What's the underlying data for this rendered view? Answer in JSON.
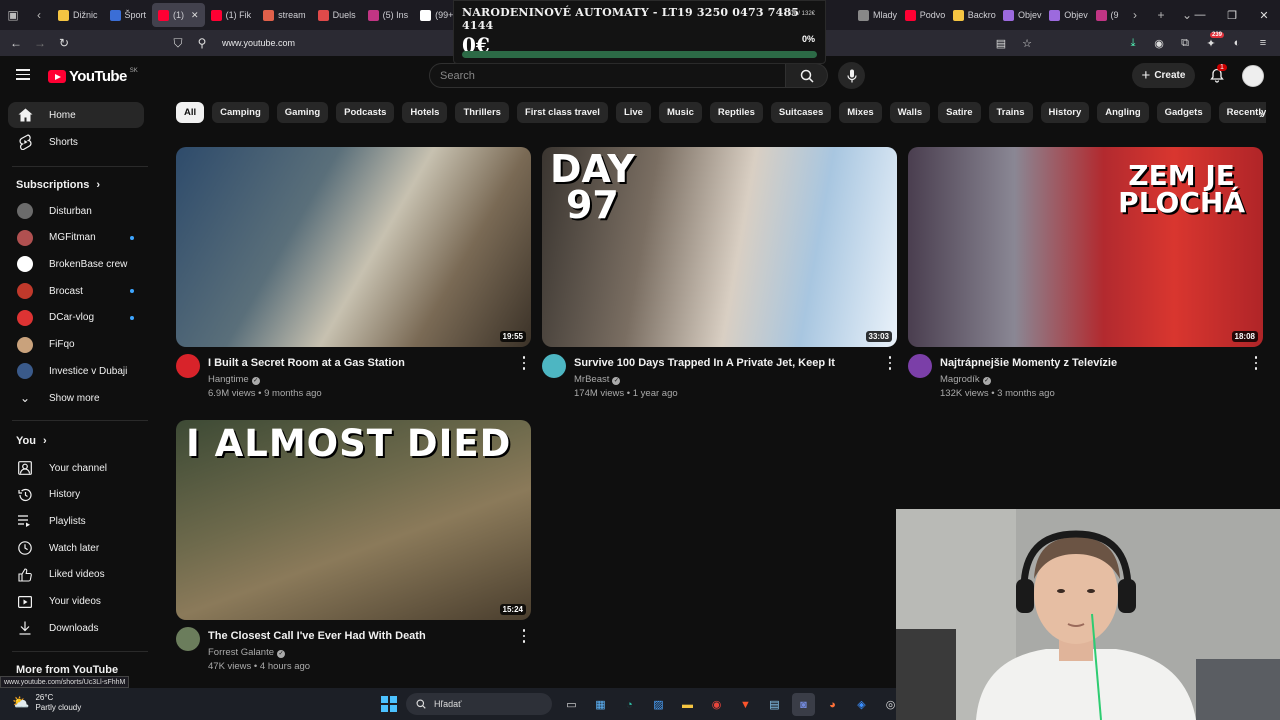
{
  "browser": {
    "tabs": [
      {
        "label": "Dižnic",
        "color": "#f5c542"
      },
      {
        "label": "Šport",
        "color": "#3b6ed6"
      },
      {
        "label": "(1)",
        "color": "#ff0033",
        "active": true
      },
      {
        "label": "(1) Fik",
        "color": "#ff0033"
      },
      {
        "label": "stream",
        "color": "#e0604a"
      },
      {
        "label": "Duels",
        "color": "#e04a4a"
      },
      {
        "label": "(5) Ins",
        "color": "#c13584"
      },
      {
        "label": "(99+)",
        "color": "#ffffff"
      }
    ],
    "tabs_right": [
      {
        "label": "Mlady",
        "color": "#888888"
      },
      {
        "label": "Podvo",
        "color": "#ff0033"
      },
      {
        "label": "Backro",
        "color": "#f5c542"
      },
      {
        "label": "Objev",
        "color": "#9c6ade"
      },
      {
        "label": "Objev",
        "color": "#9c6ade"
      },
      {
        "label": "(9",
        "color": "#c13584"
      }
    ],
    "url": "www.youtube.com",
    "ext_badge": "239",
    "status_url": "www.youtube.com/shorts/Uc3Ll-sFhhM"
  },
  "donation": {
    "title": "NARODENINOVÉ AUTOMATY - LT19 3250 0473 7485 4144",
    "goal": "0€ / 132€",
    "amount": "0€",
    "percent_label": "0%",
    "progress": 0
  },
  "header": {
    "logo": "YouTube",
    "region": "SK",
    "search_placeholder": "Search",
    "create_label": "Create",
    "notifications": "1"
  },
  "sidebar": {
    "home": "Home",
    "shorts": "Shorts",
    "subscriptions_header": "Subscriptions",
    "subscriptions": [
      {
        "name": "Disturban",
        "color": "#6b6b6b",
        "dot": false
      },
      {
        "name": "MGFitman",
        "color": "#b05050",
        "dot": true
      },
      {
        "name": "BrokenBase crew",
        "color": "#ffffff",
        "dot": false
      },
      {
        "name": "Brocast",
        "color": "#c0392b",
        "dot": true
      },
      {
        "name": "DCar-vlog",
        "color": "#d33",
        "dot": true
      },
      {
        "name": "FiFqo",
        "color": "#c9a27c",
        "dot": false
      },
      {
        "name": "Investice v Dubaji",
        "color": "#3a5a8a",
        "dot": false
      }
    ],
    "show_more": "Show more",
    "you_header": "You",
    "you_items": [
      "Your channel",
      "History",
      "Playlists",
      "Watch later",
      "Liked videos",
      "Your videos",
      "Downloads"
    ],
    "more_header": "More from YouTube"
  },
  "chips": [
    "All",
    "Camping",
    "Gaming",
    "Podcasts",
    "Hotels",
    "Thrillers",
    "First class travel",
    "Live",
    "Music",
    "Reptiles",
    "Suitcases",
    "Mixes",
    "Walls",
    "Satire",
    "Trains",
    "History",
    "Angling",
    "Gadgets",
    "Recently uploaded"
  ],
  "videos": [
    {
      "title": "I Built a Secret Room at a Gas Station",
      "channel": "Hangtime",
      "stats": "6.9M views • 9 months ago",
      "duration": "19:55",
      "avatar": "#d8232a",
      "thumb_bg": "linear-gradient(120deg,#2e4b6b 0%,#5a6f7a 35%,#c7c1b0 55%,#7a6a55 75%,#3b3228 100%)"
    },
    {
      "title": "Survive 100 Days Trapped In A Private Jet, Keep It",
      "channel": "MrBeast",
      "stats": "174M views • 1 year ago",
      "duration": "33:03",
      "avatar": "#4db6c2",
      "thumb_bg": "linear-gradient(100deg,#3a3530 0%,#7a6e62 30%,#d9cfc3 55%,#a8c6e0 75%,#eaf2fa 100%)",
      "overlay": "DAY\n97"
    },
    {
      "title": "Najtrápnejšie Momenty z Televízie",
      "channel": "Magrodík",
      "stats": "132K views • 3 months ago",
      "duration": "18:08",
      "avatar": "#7b3fa8",
      "thumb_bg": "linear-gradient(90deg,#4a3e4f 0%,#8a8794 30%,#b22a2f 55%,#d9362f 75%,#b02528 100%)",
      "overlay": "ZEM JE\nPLOCHÁ"
    },
    {
      "title": "The Closest Call I've Ever Had With Death",
      "channel": "Forrest Galante",
      "stats": "47K views • 4 hours ago",
      "duration": "15:24",
      "avatar": "#6b7d5c",
      "thumb_bg": "linear-gradient(160deg,#3d4a35 0%,#6e6a4c 40%,#8b7a5a 60%,#4a3e2e 100%)",
      "overlay": "I ALMOST DIED"
    }
  ],
  "taskbar": {
    "temp": "26°C",
    "weather": "Partly cloudy",
    "search": "Hľadať"
  }
}
